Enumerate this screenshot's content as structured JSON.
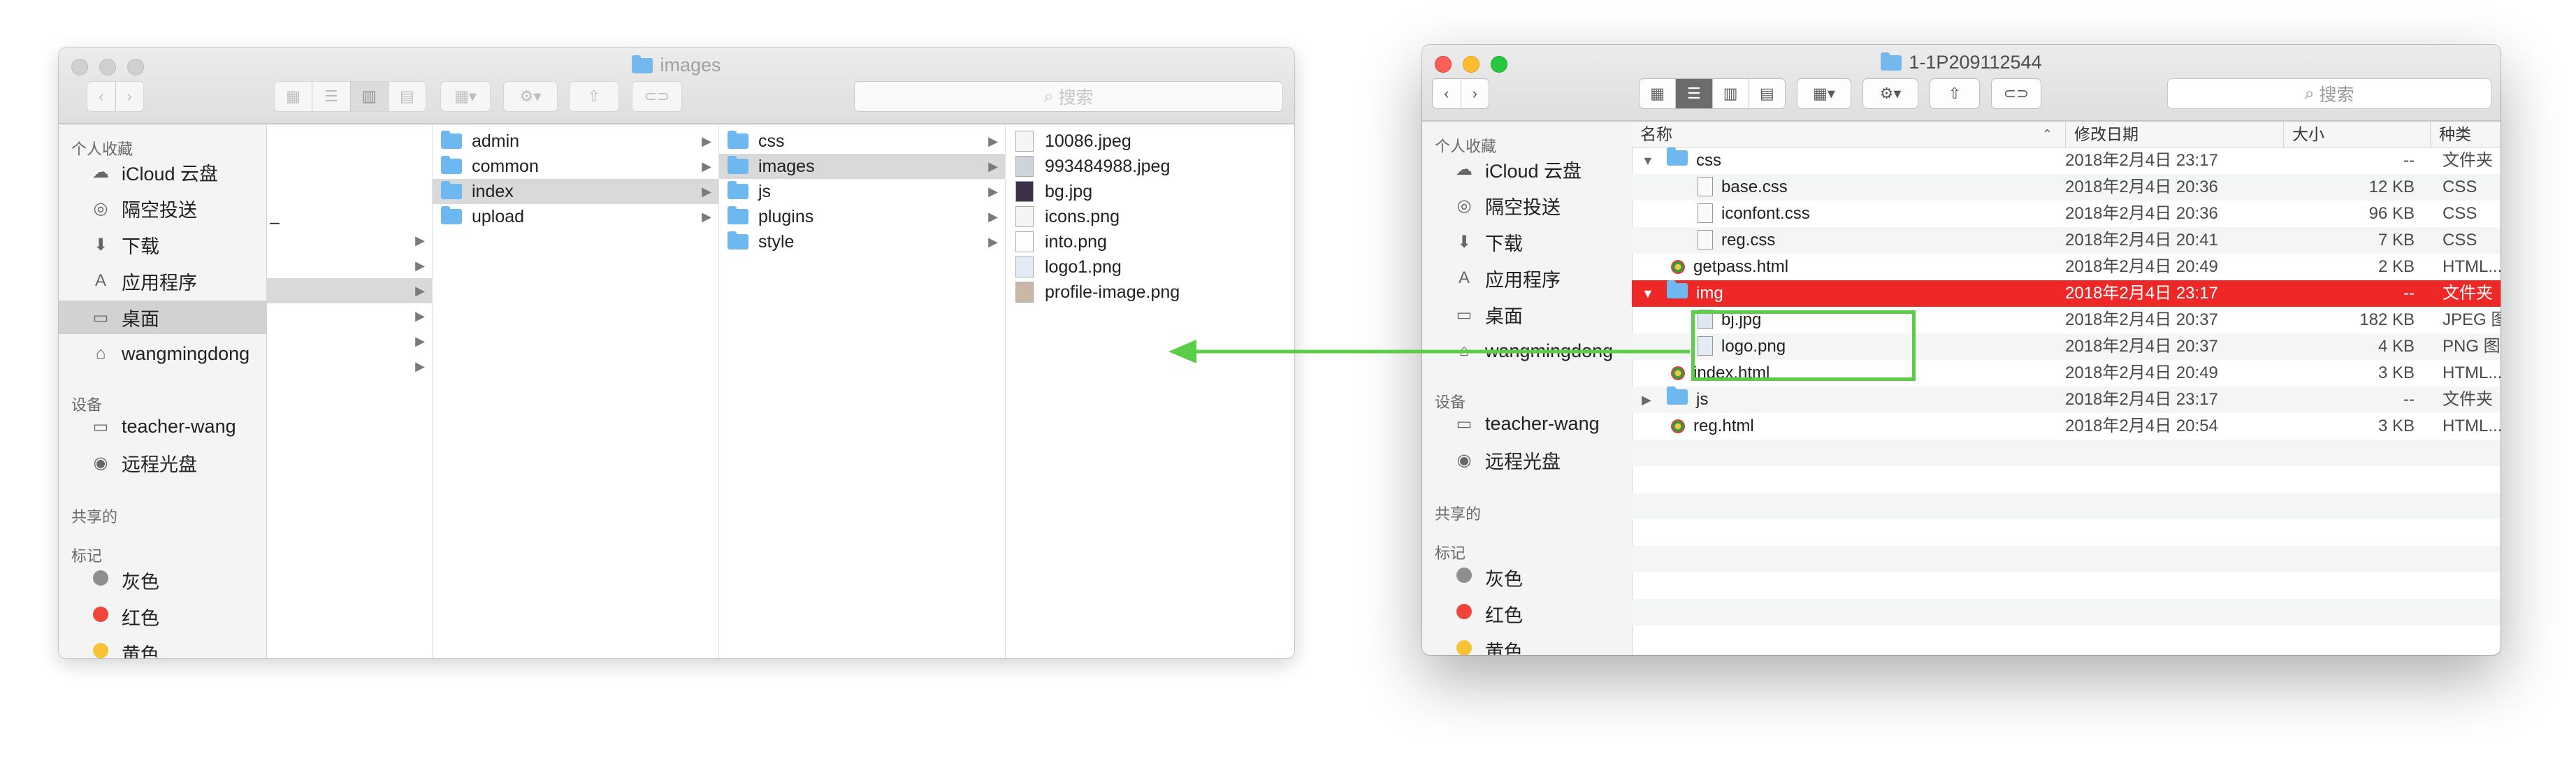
{
  "left_window": {
    "title": "images",
    "search_placeholder": "搜索",
    "sidebar": {
      "favorites_title": "个人收藏",
      "favorites": [
        {
          "label": "iCloud 云盘",
          "icon": "cloud-icon"
        },
        {
          "label": "隔空投送",
          "icon": "airdrop-icon"
        },
        {
          "label": "下载",
          "icon": "downloads-icon"
        },
        {
          "label": "应用程序",
          "icon": "applications-icon"
        },
        {
          "label": "桌面",
          "icon": "desktop-icon",
          "selected": true
        },
        {
          "label": "wangmingdong",
          "icon": "home-icon"
        }
      ],
      "devices_title": "设备",
      "devices": [
        {
          "label": "teacher-wang",
          "icon": "laptop-icon"
        },
        {
          "label": "远程光盘",
          "icon": "disc-icon"
        }
      ],
      "shared_title": "共享的",
      "tags_title": "标记",
      "tags": [
        {
          "label": "灰色",
          "color": "#8e8e8e"
        },
        {
          "label": "红色",
          "color": "#f0453b"
        },
        {
          "label": "黄色",
          "color": "#f7c233"
        }
      ]
    },
    "columns": {
      "col1_dash": "–",
      "col2": [
        "admin",
        "common",
        "index",
        "upload"
      ],
      "col3": [
        "css",
        "images",
        "js",
        "plugins",
        "style"
      ],
      "col4": [
        "10086.jpeg",
        "993484988.jpeg",
        "bg.jpg",
        "icons.png",
        "into.png",
        "logo1.png",
        "profile-image.png"
      ]
    }
  },
  "right_window": {
    "title": "1-1P209112544",
    "search_placeholder": "搜索",
    "sidebar": {
      "favorites_title": "个人收藏",
      "favorites": [
        {
          "label": "iCloud 云盘",
          "icon": "cloud-icon"
        },
        {
          "label": "隔空投送",
          "icon": "airdrop-icon"
        },
        {
          "label": "下载",
          "icon": "downloads-icon"
        },
        {
          "label": "应用程序",
          "icon": "applications-icon"
        },
        {
          "label": "桌面",
          "icon": "desktop-icon"
        },
        {
          "label": "wangmingdong",
          "icon": "home-icon"
        }
      ],
      "devices_title": "设备",
      "devices": [
        {
          "label": "teacher-wang",
          "icon": "laptop-icon"
        },
        {
          "label": "远程光盘",
          "icon": "disc-icon"
        }
      ],
      "shared_title": "共享的",
      "tags_title": "标记",
      "tags": [
        {
          "label": "灰色",
          "color": "#8e8e8e"
        },
        {
          "label": "红色",
          "color": "#f0453b"
        },
        {
          "label": "黄色",
          "color": "#f7c233"
        }
      ]
    },
    "list_header": {
      "name": "名称",
      "date": "修改日期",
      "size": "大小",
      "kind": "种类"
    },
    "rows": [
      {
        "name": "css",
        "date": "2018年2月4日 23:17",
        "size": "--",
        "kind": "文件夹"
      },
      {
        "name": "base.css",
        "date": "2018年2月4日 20:36",
        "size": "12 KB",
        "kind": "CSS"
      },
      {
        "name": "iconfont.css",
        "date": "2018年2月4日 20:36",
        "size": "96 KB",
        "kind": "CSS"
      },
      {
        "name": "reg.css",
        "date": "2018年2月4日 20:41",
        "size": "7 KB",
        "kind": "CSS"
      },
      {
        "name": "getpass.html",
        "date": "2018年2月4日 20:49",
        "size": "2 KB",
        "kind": "HTML...ocu"
      },
      {
        "name": "img",
        "date": "2018年2月4日 23:17",
        "size": "--",
        "kind": "文件夹"
      },
      {
        "name": "bj.jpg",
        "date": "2018年2月4日 20:37",
        "size": "182 KB",
        "kind": "JPEG 图像"
      },
      {
        "name": "logo.png",
        "date": "2018年2月4日 20:37",
        "size": "4 KB",
        "kind": "PNG 图像"
      },
      {
        "name": "index.html",
        "date": "2018年2月4日 20:49",
        "size": "3 KB",
        "kind": "HTML...ocu"
      },
      {
        "name": "js",
        "date": "2018年2月4日 23:17",
        "size": "--",
        "kind": "文件夹"
      },
      {
        "name": "reg.html",
        "date": "2018年2月4日 20:54",
        "size": "3 KB",
        "kind": "HTML...ocu"
      }
    ]
  },
  "annotation": {
    "highlight_color": "#5ccd49",
    "arrow_color": "#5ccd49"
  },
  "colors": {
    "selection_red": "#ee2727",
    "folder_blue": "#6db8f0"
  }
}
